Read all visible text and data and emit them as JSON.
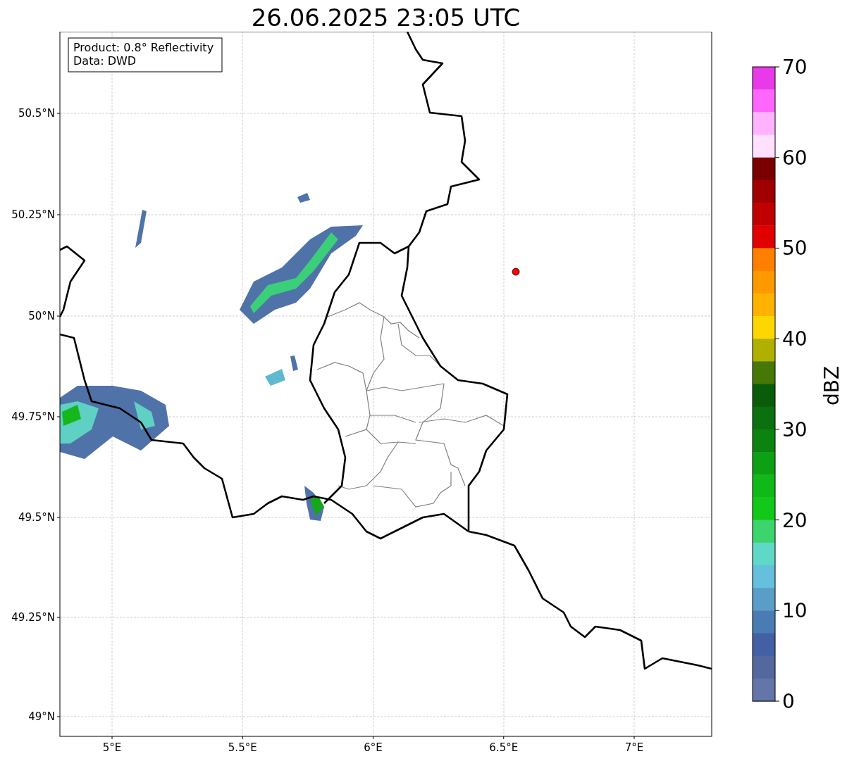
{
  "title": "26.06.2025 23:05 UTC",
  "info_box": {
    "lines": [
      "Product: 0.8° Reflectivity",
      "Data: DWD"
    ]
  },
  "map": {
    "lon_ticks": [
      "5°E",
      "5.5°E",
      "6°E",
      "6.5°E",
      "7°E"
    ],
    "lat_ticks": [
      "50.5°N",
      "50.25°N",
      "50°N",
      "49.75°N",
      "49.5°N",
      "49.25°N",
      "49°N"
    ]
  },
  "colorbar": {
    "label": "dBZ",
    "ticks": [
      "70",
      "60",
      "50",
      "40",
      "30",
      "20",
      "10",
      "0"
    ],
    "segments": [
      {
        "color": "#e83ae8"
      },
      {
        "color": "#ff66ff"
      },
      {
        "color": "#ffb3ff"
      },
      {
        "color": "#ffe0ff"
      },
      {
        "color": "#7a0000"
      },
      {
        "color": "#a00000"
      },
      {
        "color": "#c00000"
      },
      {
        "color": "#e00000"
      },
      {
        "color": "#ff8000"
      },
      {
        "color": "#ff9900"
      },
      {
        "color": "#ffb300"
      },
      {
        "color": "#ffd700"
      },
      {
        "color": "#b0b000"
      },
      {
        "color": "#467808"
      },
      {
        "color": "#0a5c0a"
      },
      {
        "color": "#0a7010"
      },
      {
        "color": "#0c8210"
      },
      {
        "color": "#0ea014"
      },
      {
        "color": "#10b818"
      },
      {
        "color": "#12c818"
      },
      {
        "color": "#3cd46c"
      },
      {
        "color": "#60d8c8"
      },
      {
        "color": "#64c0dc"
      },
      {
        "color": "#5a9ec8"
      },
      {
        "color": "#4a7cb4"
      },
      {
        "color": "#4460a4"
      },
      {
        "color": "#5468a0"
      },
      {
        "color": "#6476a8"
      }
    ]
  }
}
